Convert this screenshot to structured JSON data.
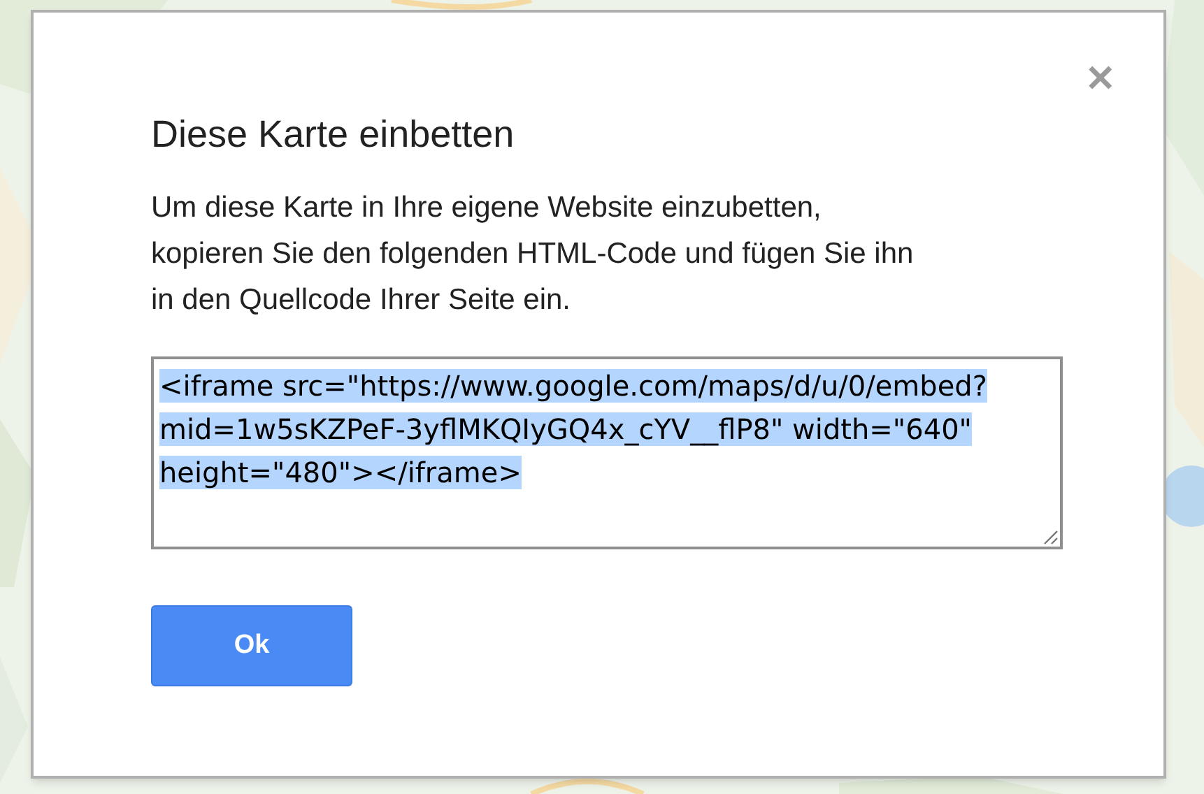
{
  "dialog": {
    "title": "Diese Karte einbetten",
    "close": "✕",
    "description": "Um diese Karte in Ihre eigene Website einzubetten, kopieren Sie den folgenden HTML-Code und fügen Sie ihn in den Quellcode Ihrer Seite ein.",
    "code": {
      "value": "<iframe src=\"https://www.google.com/maps/d/u/0/embed?mid=1w5sKZPeF-3yflMKQIyGQ4x_cYV__flP8\" width=\"640\" height=\"480\"></iframe>",
      "selected": true
    },
    "buttons": [
      {
        "label": "Ok",
        "kind": "primary"
      }
    ]
  }
}
